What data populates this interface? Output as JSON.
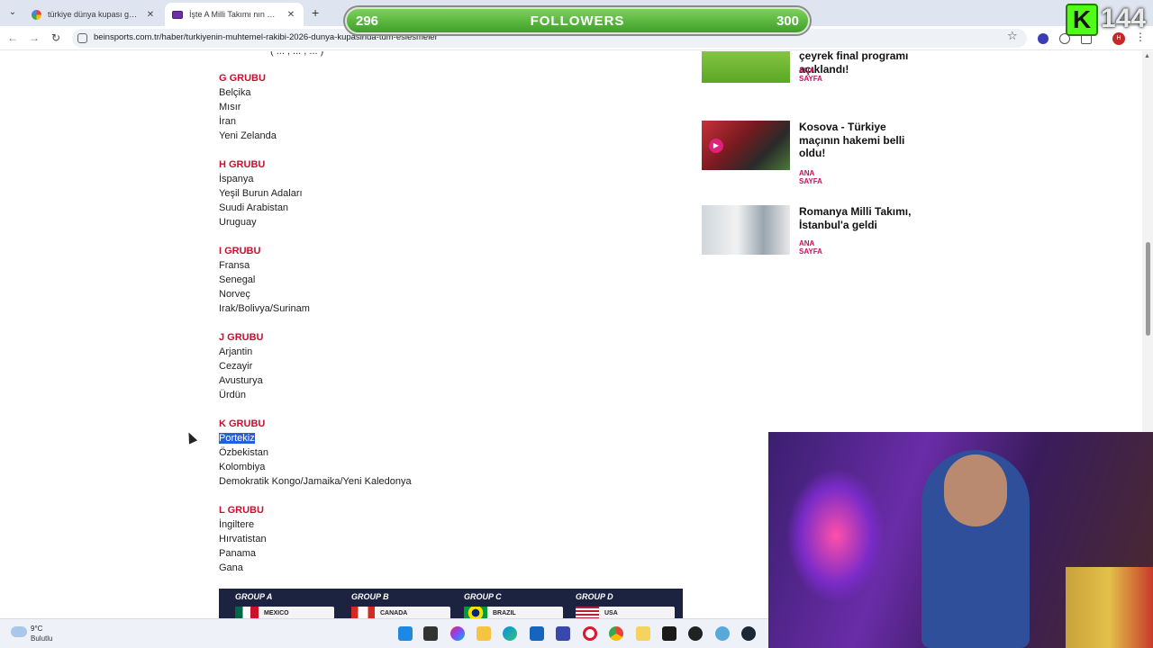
{
  "browser": {
    "tabs": [
      {
        "title": "türkiye dünya kupası gruplar - Ar",
        "active": false
      },
      {
        "title": "İşte A Milli Takımı nın Dünya Kupa",
        "active": true
      }
    ],
    "url": "beinsports.com.tr/haber/turkiyenin-muhtemel-rakibi-2026-dunya-kupasinda-tum-eslesmeler"
  },
  "overlay": {
    "followers_current": "296",
    "followers_label": "FOLLOWERS",
    "followers_goal": "300",
    "kick_logo": "K",
    "kick_count": "144"
  },
  "groups": [
    {
      "name": "G GRUBU",
      "teams": [
        "Belçika",
        "Mısır",
        "İran",
        "Yeni Zelanda"
      ]
    },
    {
      "name": "H GRUBU",
      "teams": [
        "İspanya",
        "Yeşil Burun Adaları",
        "Suudi Arabistan",
        "Uruguay"
      ]
    },
    {
      "name": "I GRUBU",
      "teams": [
        "Fransa",
        "Senegal",
        "Norveç",
        "Irak/Bolivya/Surinam"
      ]
    },
    {
      "name": "J GRUBU",
      "teams": [
        "Arjantin",
        "Cezayir",
        "Avusturya",
        "Ürdün"
      ]
    },
    {
      "name": "K GRUBU",
      "teams": [
        "Portekiz",
        "Özbekistan",
        "Kolombiya",
        "Demokratik Kongo/Jamaika/Yeni Kaledonya"
      ]
    },
    {
      "name": "L GRUBU",
      "teams": [
        "İngiltere",
        "Hırvatistan",
        "Panama",
        "Gana"
      ]
    }
  ],
  "selected_team": "Portekiz",
  "banner": [
    {
      "group": "GROUP A",
      "country": "MEXICO"
    },
    {
      "group": "GROUP B",
      "country": "CANADA"
    },
    {
      "group": "GROUP C",
      "country": "BRAZIL"
    },
    {
      "group": "GROUP D",
      "country": "USA"
    }
  ],
  "sidebar_articles": [
    {
      "title": "çeyrek final programı açıklandı!",
      "category": "ANA SAYFA"
    },
    {
      "title": "Kosova - Türkiye maçının hakemi belli oldu!",
      "category": "ANA SAYFA"
    },
    {
      "title": "Romanya Milli Takımı, İstanbul'a geldi",
      "category": "ANA SAYFA"
    }
  ],
  "taskbar": {
    "weather_temp": "9°C",
    "weather_desc": "Bulutlu"
  },
  "colors": {
    "group_heading": "#c8102e",
    "category": "#c8105e",
    "selection": "#2460d8",
    "followers_bar": "#4caf2e"
  }
}
